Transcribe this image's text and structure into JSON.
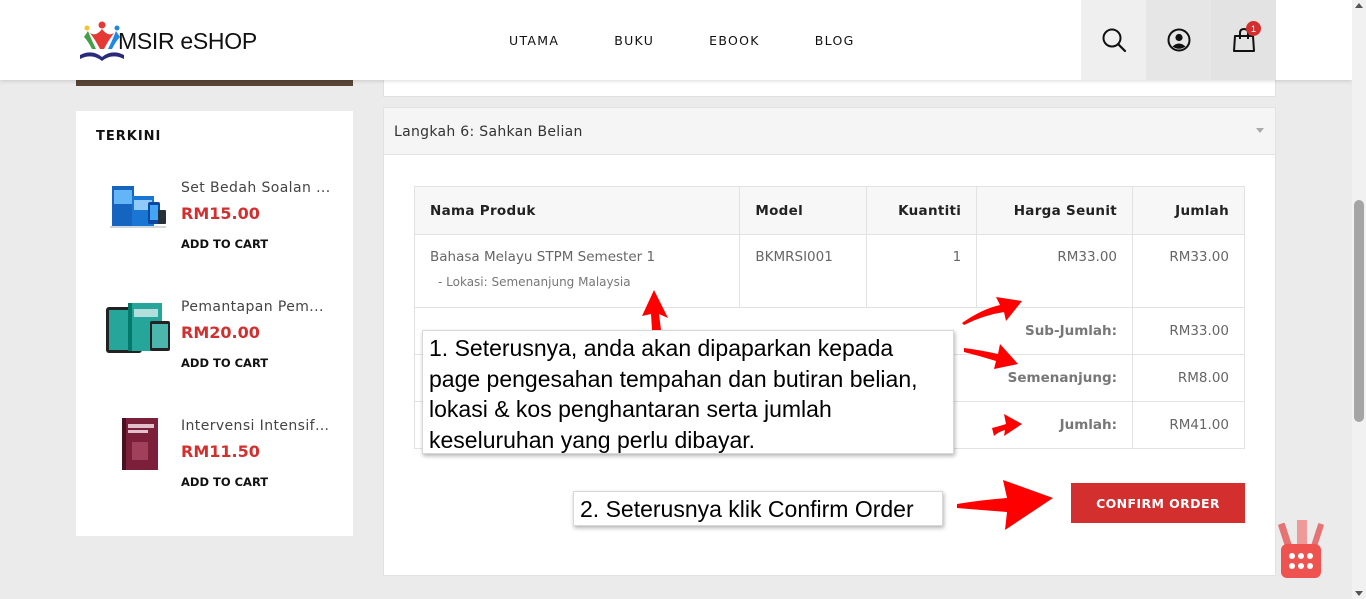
{
  "header": {
    "logo_text": "MSIR eSHOP",
    "nav": [
      {
        "label": "UTAMA"
      },
      {
        "label": "BUKU"
      },
      {
        "label": "EBOOK"
      },
      {
        "label": "BLOG"
      }
    ],
    "cart_count": "1",
    "icons": {
      "search": "search-icon",
      "account": "user-icon",
      "cart": "shopping-bag-icon"
    }
  },
  "sidebar": {
    "title": "TERKINI",
    "products": [
      {
        "name": "Set Bedah Soalan ...",
        "price": "RM15.00",
        "action": "ADD TO CART"
      },
      {
        "name": "Pemantapan Pem...",
        "price": "RM20.00",
        "action": "ADD TO CART"
      },
      {
        "name": "Intervensi Intensif ...",
        "price": "RM11.50",
        "action": "ADD TO CART"
      }
    ]
  },
  "checkout": {
    "step_title": "Langkah 6: Sahkan Belian",
    "table": {
      "headers": [
        "Nama Produk",
        "Model",
        "Kuantiti",
        "Harga Seunit",
        "Jumlah"
      ],
      "row": {
        "name": "Bahasa Melayu STPM Semester 1",
        "option": "- Lokasi: Semenanjung Malaysia",
        "model": "BKMRSI001",
        "qty": "1",
        "unit_price": "RM33.00",
        "total": "RM33.00"
      },
      "totals": [
        {
          "label": "Sub-Jumlah:",
          "value": "RM33.00"
        },
        {
          "label": "Semenanjung:",
          "value": "RM8.00"
        },
        {
          "label": "Jumlah:",
          "value": "RM41.00"
        }
      ]
    },
    "confirm_label": "CONFIRM ORDER"
  },
  "annotations": {
    "note1_lines": [
      "1. Seterusnya, anda akan dipaparkan kepada",
      "page pengesahan tempahan dan butiran belian,",
      "lokasi & kos penghantaran serta jumlah",
      "keseluruhan yang perlu dibayar."
    ],
    "note2": "2. Seterusnya klik Confirm Order",
    "arrow_color": "#ff0000"
  },
  "colors": {
    "accent": "#d32f2f"
  }
}
